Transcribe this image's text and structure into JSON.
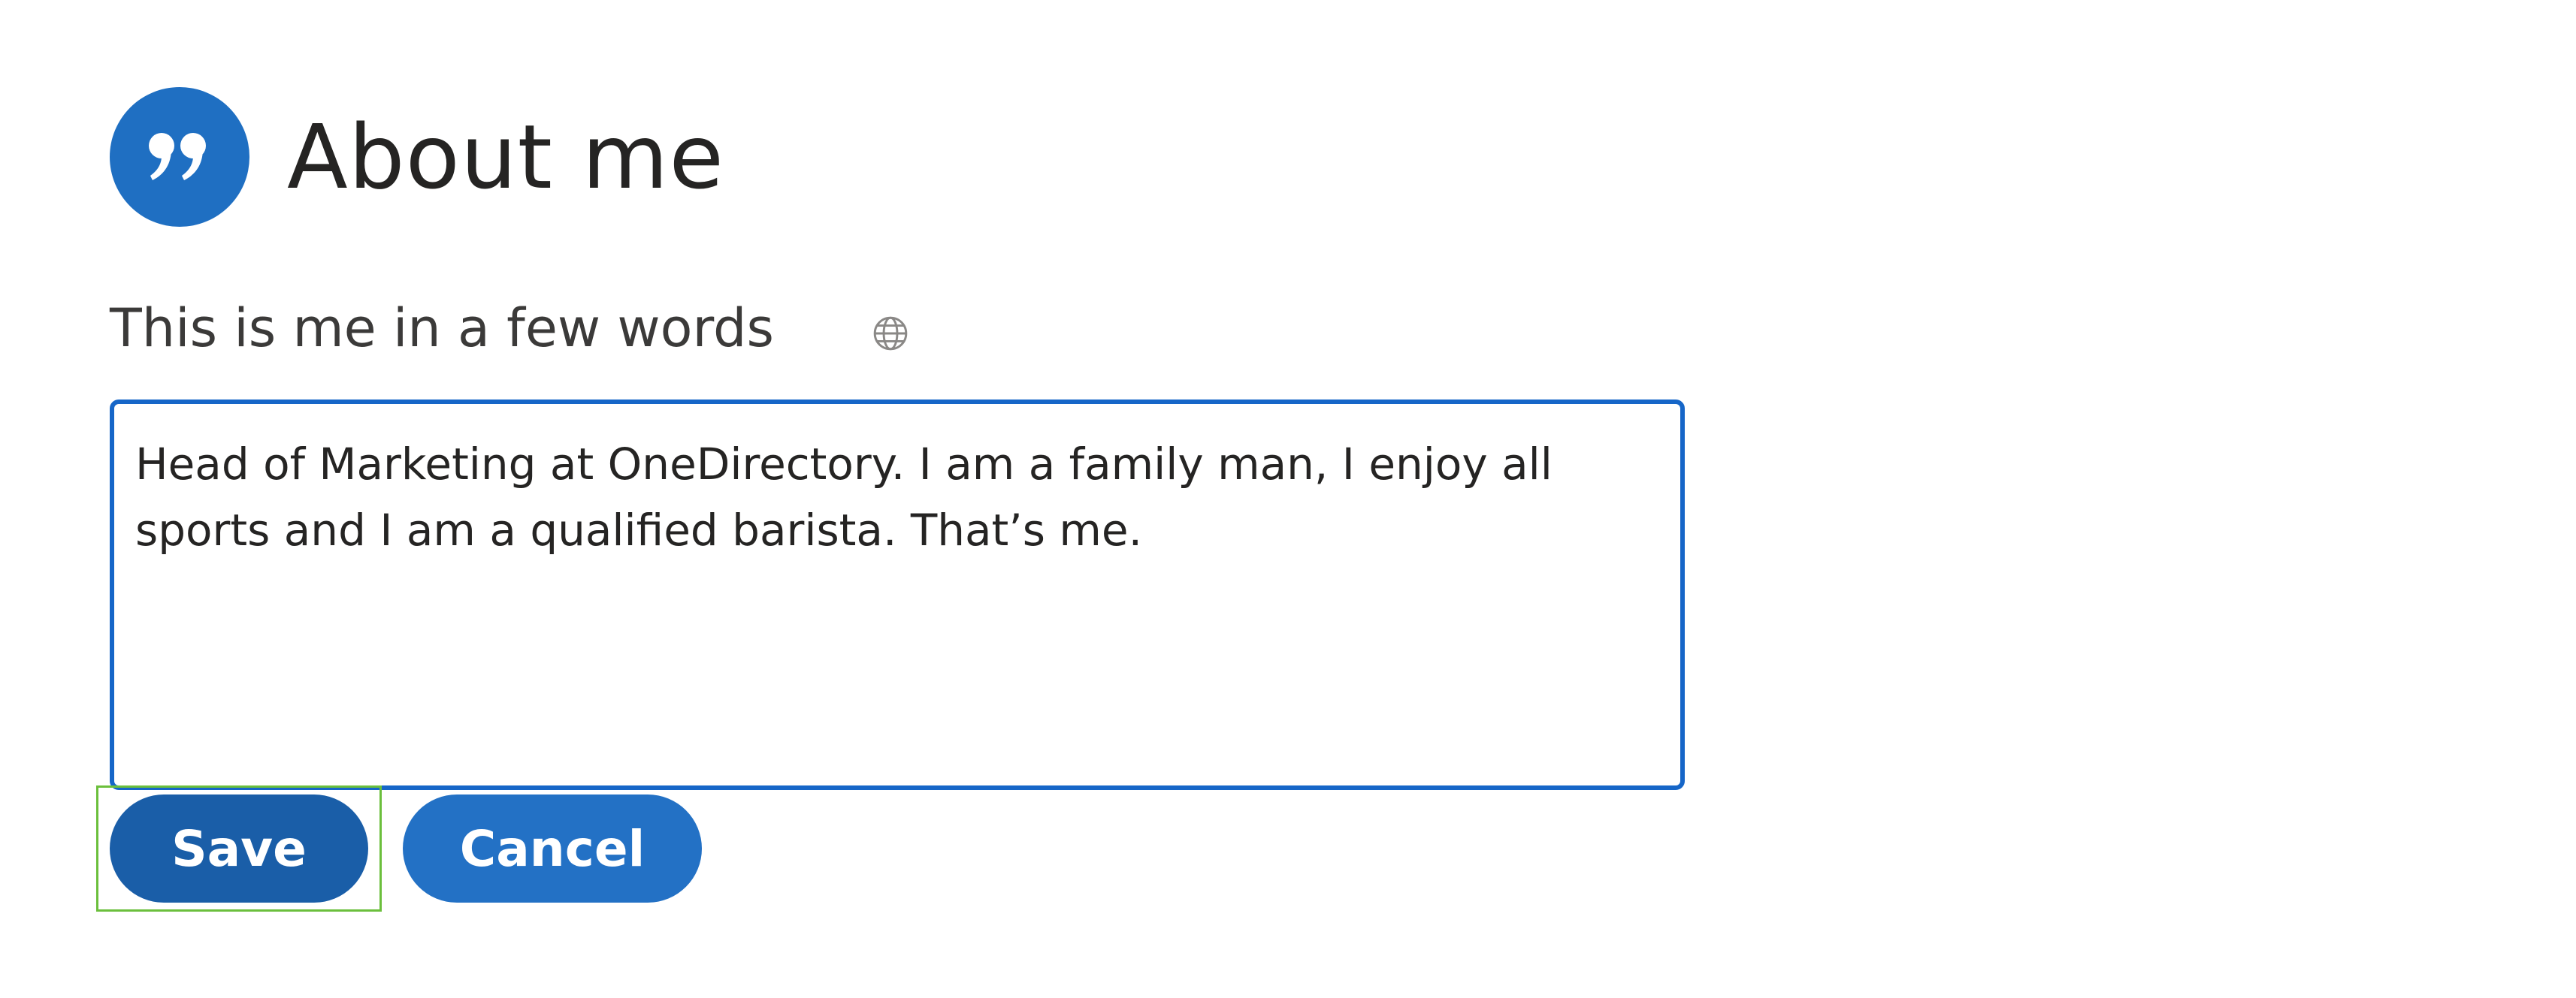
{
  "header": {
    "icon": "quote-icon",
    "title": "About me"
  },
  "field": {
    "label": "This is me in a few words",
    "visibility_icon": "globe-icon",
    "value": "Head of Marketing at OneDirectory. I am a family man, I enjoy all sports and I am a qualified barista. That’s me."
  },
  "actions": {
    "save_label": "Save",
    "cancel_label": "Cancel"
  },
  "colors": {
    "accent": "#1f6fc2",
    "save_button": "#1a5ea8",
    "cancel_button": "#2371c5",
    "textarea_border": "#1666c8",
    "focus_ring": "#6bbf3c"
  }
}
